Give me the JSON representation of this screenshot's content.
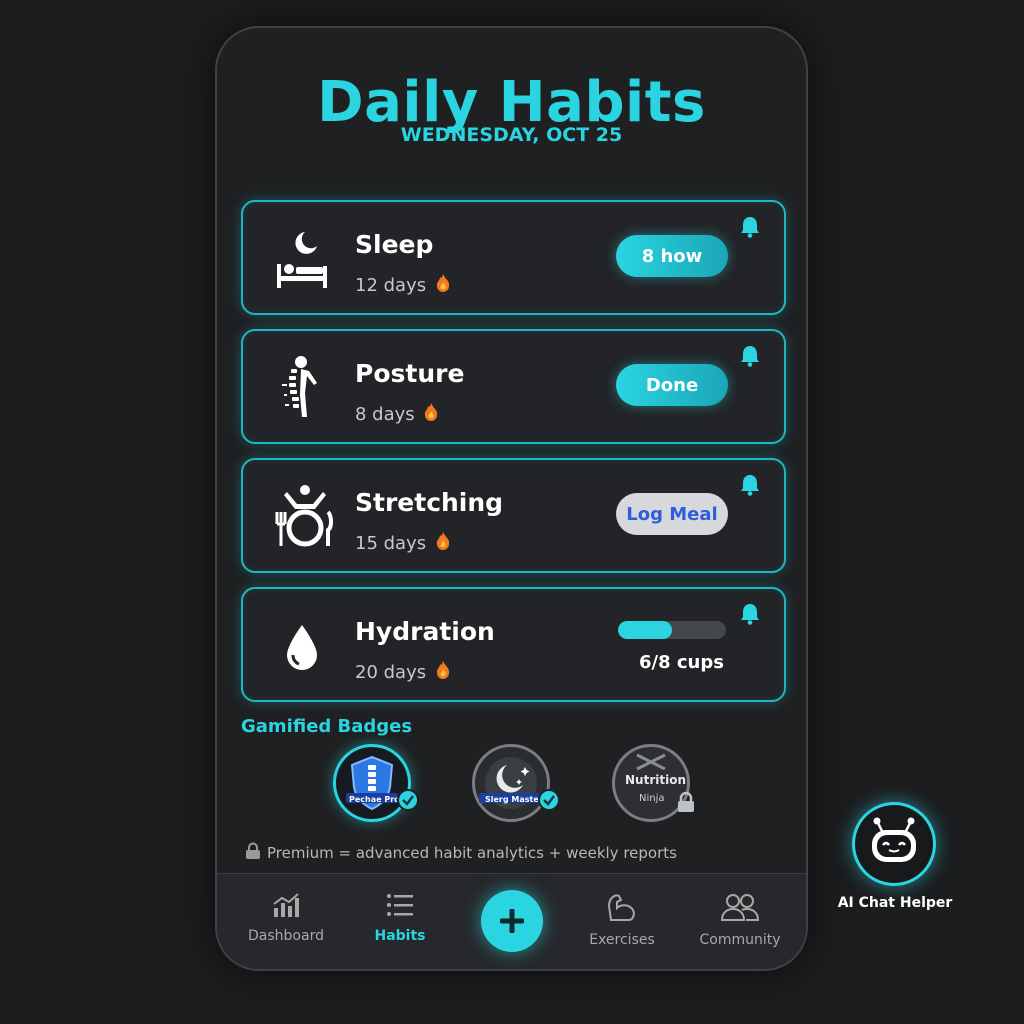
{
  "header": {
    "title": "Daily Habits",
    "date": "WEDNESDAY, OCT 25"
  },
  "habits": [
    {
      "name": "Sleep",
      "streak": "12 days",
      "icon": "sleep-bed-moon-icon",
      "action": "8 how"
    },
    {
      "name": "Posture",
      "streak": "8 days",
      "icon": "posture-spine-icon",
      "action": "Done"
    },
    {
      "name": "Stretching",
      "streak": "15 days",
      "icon": "stretching-plate-icon",
      "action": "Log Meal"
    },
    {
      "name": "Hydration",
      "streak": "20 days",
      "icon": "water-drop-icon",
      "progress": 0.5,
      "progress_text": "6/8 cups"
    }
  ],
  "badges": {
    "title": "Gamified Badges",
    "items": [
      {
        "label": "Pechae Pro",
        "icon": "shield-spine-icon",
        "earned": true
      },
      {
        "label": "Slerg Master",
        "icon": "moon-stars-icon",
        "earned": true
      },
      {
        "label_line1": "Nutrition",
        "label_line2": "Ninja",
        "icon": "fork-knife-icon",
        "earned": false
      }
    ]
  },
  "premium": {
    "text": "Premium = advanced habit analytics + weekly reports"
  },
  "nav": {
    "items": [
      {
        "label": "Dashboard",
        "icon": "bar-chart-icon"
      },
      {
        "label": "Habits",
        "icon": "list-icon",
        "active": true
      },
      {
        "label": "Exercises",
        "icon": "flexed-arm-icon"
      },
      {
        "label": "Community",
        "icon": "people-icon"
      }
    ],
    "add_icon": "plus-icon"
  },
  "helper": {
    "label": "AI Chat Helper",
    "icon": "robot-face-icon"
  },
  "colors": {
    "accent": "#2ad4e0",
    "background": "#1c1d1f",
    "card": "#222427",
    "link_blue": "#2f5fd8"
  }
}
